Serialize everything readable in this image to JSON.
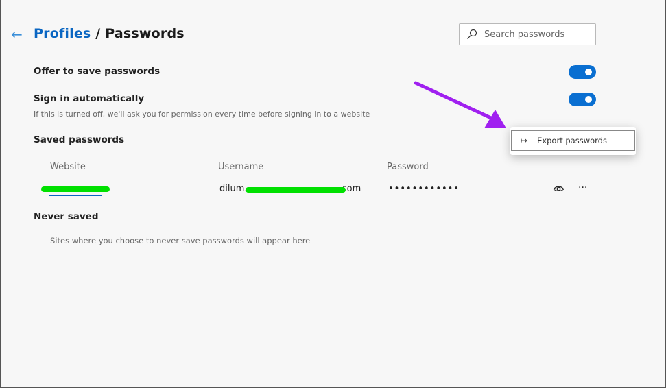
{
  "header": {
    "back_icon": "arrow-left-icon",
    "breadcrumb_parent": "Profiles",
    "separator": " / ",
    "title": "Passwords"
  },
  "search": {
    "placeholder": "Search passwords",
    "icon": "search-icon"
  },
  "settings": {
    "offer_to_save": {
      "label": "Offer to save passwords",
      "enabled": true
    },
    "sign_in_auto": {
      "label": "Sign in automatically",
      "description": "If this is turned off, we'll ask you for permission every time before signing in to a website",
      "enabled": true
    }
  },
  "saved": {
    "heading": "Saved passwords",
    "columns": [
      "Website",
      "Username",
      "Password"
    ],
    "rows": [
      {
        "username_prefix": "dilum.",
        "username_suffix": "com",
        "password": "••••••••••••"
      }
    ]
  },
  "never_saved": {
    "heading": "Never saved",
    "empty_text": "Sites where you choose to never save passwords will appear here"
  },
  "context_menu": {
    "items": [
      {
        "label": "Export passwords",
        "icon": "export-icon"
      }
    ]
  },
  "colors": {
    "accent": "#0a6fd1",
    "redaction": "#00e000",
    "annotation_arrow": "#a020f0"
  }
}
